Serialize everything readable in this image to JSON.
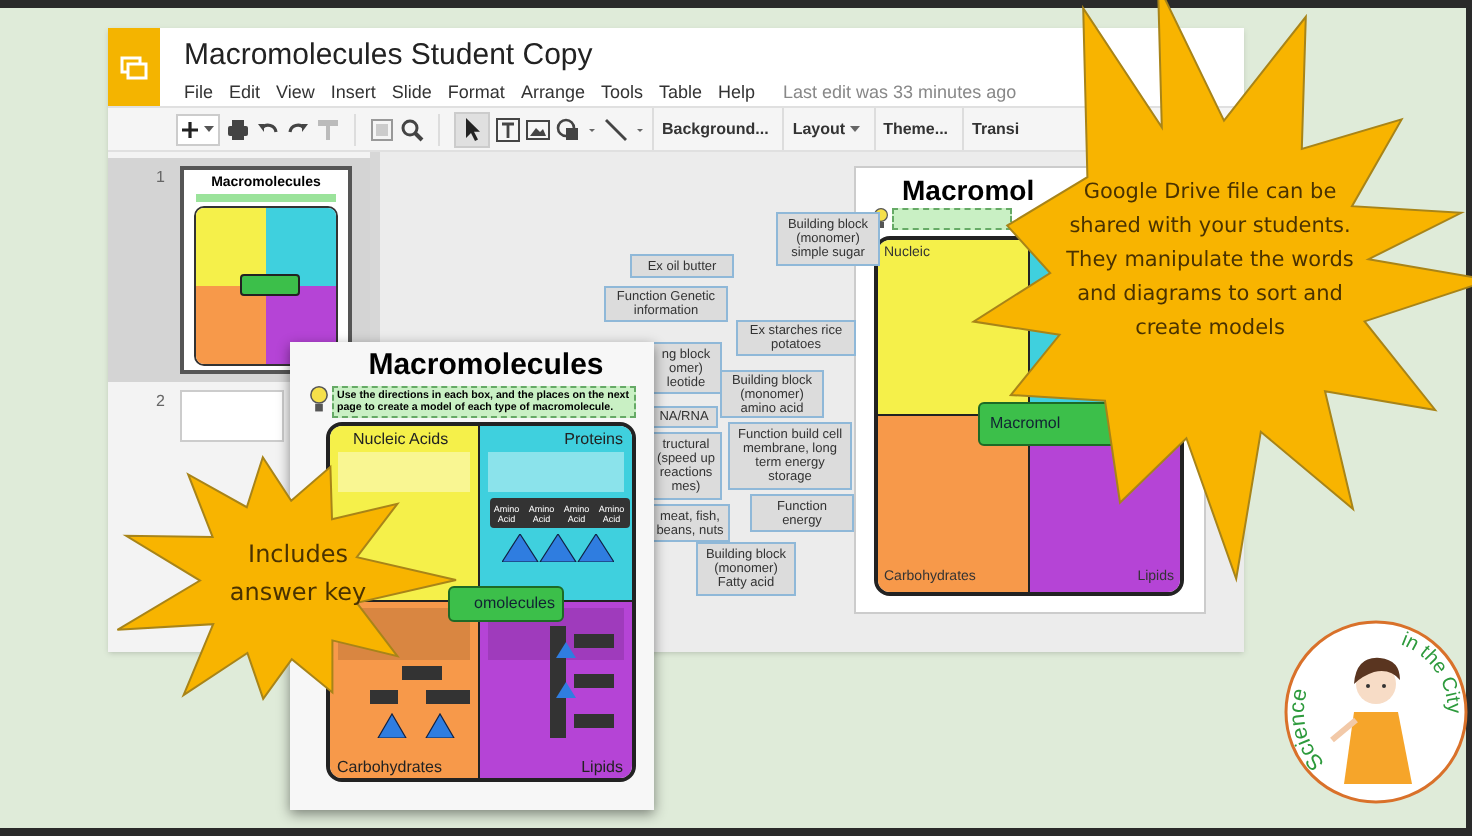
{
  "app": {
    "title": "Macromolecules Student Copy",
    "menu": [
      "File",
      "Edit",
      "View",
      "Insert",
      "Slide",
      "Format",
      "Arrange",
      "Tools",
      "Table",
      "Help"
    ],
    "last_edit": "Last edit was 33 minutes ago",
    "toolbar_buttons": [
      {
        "label": "Background...",
        "kind": "plain"
      },
      {
        "label": "Layout",
        "kind": "dropdown"
      },
      {
        "label": "Theme...",
        "kind": "plain"
      },
      {
        "label": "Transi",
        "kind": "plain"
      }
    ]
  },
  "filmstrip": [
    {
      "number": "1",
      "selected": true,
      "thumbnail_title": "Macromolecules"
    },
    {
      "number": "2",
      "selected": false
    }
  ],
  "canvas_cards": [
    {
      "text": "Building block (monomer) simple sugar"
    },
    {
      "text": "Ex oil butter"
    },
    {
      "text": "Function Genetic information"
    },
    {
      "text": "Ex starches rice potatoes"
    },
    {
      "text": "ng block omer) leotide"
    },
    {
      "text": "Building block (monomer) amino acid"
    },
    {
      "text": "NA/RNA"
    },
    {
      "text": "tructural (speed up reactions mes)"
    },
    {
      "text": "Function build cell membrane, long term energy storage"
    },
    {
      "text": "Function energy"
    },
    {
      "text": "meat, fish, beans, nuts"
    },
    {
      "text": "Building block (monomer) Fatty acid"
    }
  ],
  "slide": {
    "title": "Macromol",
    "quadrants": [
      {
        "label": "Nucleic",
        "color": "#f5f04a"
      },
      {
        "color": "#3fd0de"
      },
      {
        "label": "Carbohydrates",
        "color": "#f7994a"
      },
      {
        "label": "Lipids",
        "color": "#b544d6"
      }
    ],
    "center_label": "Macromol"
  },
  "worksheet": {
    "title": "Macromolecules",
    "instructions": "Use the directions in each box, and the places on the next page to create a model of each type of macromolecule.",
    "quadrants": [
      {
        "label": "Nucleic Acids",
        "color": "#f5f04a"
      },
      {
        "label": "Proteins",
        "color": "#3fd0de"
      },
      {
        "label": "Carbohydrates",
        "color": "#f7994a"
      },
      {
        "label": "Lipids",
        "color": "#b544d6"
      }
    ],
    "amino_labels": [
      "Amino Acid",
      "Amino Acid",
      "Amino Acid",
      "Amino Acid"
    ],
    "center_label": "omolecules"
  },
  "callouts": [
    {
      "text": "Google Drive file can be shared with your students. They manipulate the words and diagrams to sort and create models"
    },
    {
      "text": "Includes answer key"
    }
  ],
  "logo": {
    "arc_left": "Science",
    "arc_right": "in the City"
  }
}
